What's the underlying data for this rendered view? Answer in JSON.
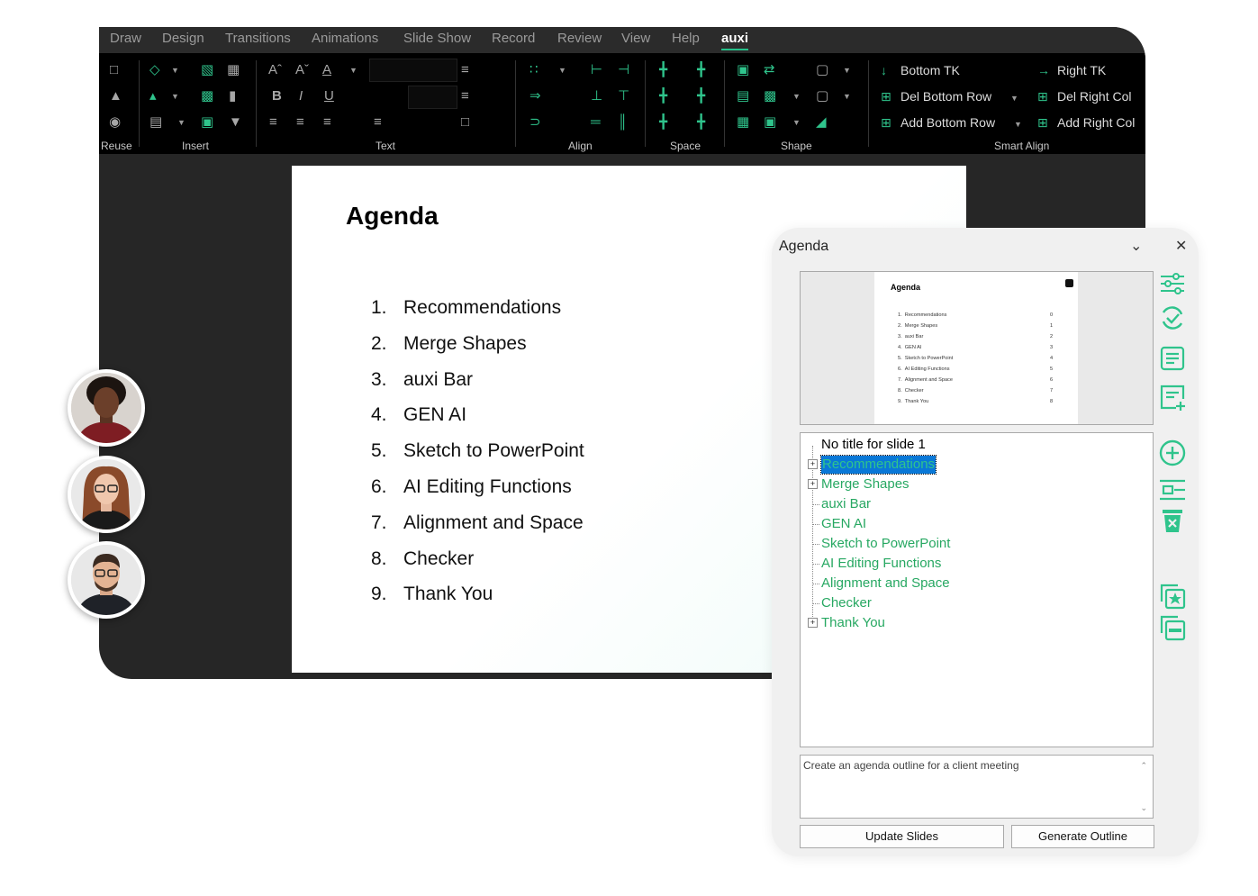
{
  "ribbon": {
    "tabs": [
      "Draw",
      "Design",
      "Transitions",
      "Animations",
      "Slide Show",
      "Record",
      "Review",
      "View",
      "Help",
      "auxi"
    ],
    "active_tab": "auxi",
    "groups": [
      "Reuse",
      "Insert",
      "Text",
      "Align",
      "Space",
      "Shape",
      "Smart Align"
    ],
    "format": {
      "bold": "B",
      "italic": "I",
      "underline": "U"
    },
    "smart_align": {
      "bottom_tk": "Bottom TK",
      "right_tk": "Right TK",
      "del_bottom_row": "Del Bottom Row",
      "del_right_col": "Del Right Col",
      "add_bottom_row": "Add Bottom Row",
      "add_right_col": "Add Right Col"
    },
    "accent_color": "#2fc48c"
  },
  "slide": {
    "title": "Agenda",
    "items": [
      {
        "num": "1.",
        "text": "Recommendations"
      },
      {
        "num": "2.",
        "text": "Merge Shapes"
      },
      {
        "num": "3.",
        "text": "auxi Bar"
      },
      {
        "num": "4.",
        "text": "GEN AI"
      },
      {
        "num": "5.",
        "text": "Sketch to PowerPoint"
      },
      {
        "num": "6.",
        "text": "AI Editing Functions"
      },
      {
        "num": "7.",
        "text": "Alignment and Space"
      },
      {
        "num": "8.",
        "text": "Checker"
      },
      {
        "num": "9.",
        "text": "Thank You"
      }
    ]
  },
  "pane": {
    "title": "Agenda",
    "preview": {
      "title": "Agenda",
      "rows": [
        {
          "num": "1.",
          "text": "Recommendations",
          "page": "0"
        },
        {
          "num": "2.",
          "text": "Merge Shapes",
          "page": "1"
        },
        {
          "num": "3.",
          "text": "auxi Bar",
          "page": "2"
        },
        {
          "num": "4.",
          "text": "GEN AI",
          "page": "3"
        },
        {
          "num": "5.",
          "text": "Sketch to PowerPoint",
          "page": "4"
        },
        {
          "num": "6.",
          "text": "AI Editing Functions",
          "page": "5"
        },
        {
          "num": "7.",
          "text": "Alignment and Space",
          "page": "6"
        },
        {
          "num": "8.",
          "text": "Checker",
          "page": "7"
        },
        {
          "num": "9.",
          "text": "Thank You",
          "page": "8"
        }
      ]
    },
    "tree": {
      "root": "No title for slide 1",
      "nodes": [
        {
          "text": "Recommendations",
          "expandable": true,
          "selected": true
        },
        {
          "text": "Merge Shapes",
          "expandable": true,
          "selected": false
        },
        {
          "text": "auxi Bar",
          "expandable": false,
          "selected": false
        },
        {
          "text": "GEN AI",
          "expandable": false,
          "selected": false
        },
        {
          "text": "Sketch to PowerPoint",
          "expandable": false,
          "selected": false
        },
        {
          "text": "AI Editing Functions",
          "expandable": false,
          "selected": false
        },
        {
          "text": "Alignment and Space",
          "expandable": false,
          "selected": false
        },
        {
          "text": "Checker",
          "expandable": false,
          "selected": false
        },
        {
          "text": "Thank You",
          "expandable": true,
          "selected": false
        }
      ]
    },
    "prompt_text": "Create an agenda outline for a client meeting",
    "buttons": {
      "update": "Update Slides",
      "generate": "Generate Outline"
    },
    "side_icons": [
      "settings-sliders-icon",
      "refresh-check-icon",
      "outline-list-icon",
      "add-list-icon",
      "add-circle-icon",
      "insert-row-icon",
      "delete-icon",
      "star-copy-icon",
      "collapse-icon"
    ]
  }
}
